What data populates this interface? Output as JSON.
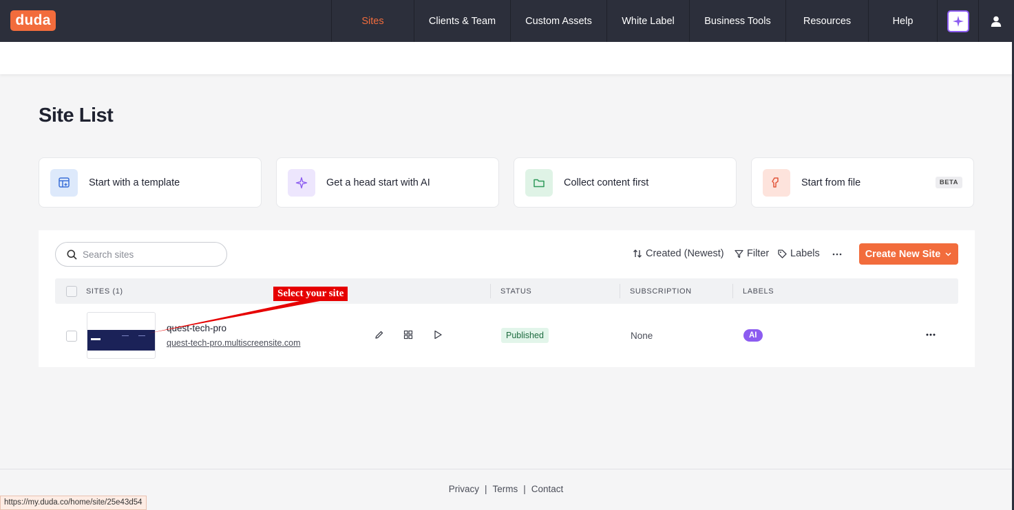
{
  "logo": "duda",
  "nav": {
    "items": [
      "Sites",
      "Clients & Team",
      "Custom Assets",
      "White Label",
      "Business Tools",
      "Resources",
      "Help"
    ]
  },
  "page_title": "Site List",
  "cards": [
    {
      "label": "Start with a template",
      "icon": "template-icon"
    },
    {
      "label": "Get a head start with AI",
      "icon": "sparkle-icon"
    },
    {
      "label": "Collect content first",
      "icon": "folder-icon"
    },
    {
      "label": "Start from file",
      "icon": "file-icon",
      "badge": "BETA"
    }
  ],
  "search": {
    "placeholder": "Search sites"
  },
  "toolbar": {
    "sort_label": "Created (Newest)",
    "filter_label": "Filter",
    "labels_label": "Labels",
    "create_label": "Create New Site"
  },
  "table": {
    "headers": [
      "SITES (1)",
      "STATUS",
      "SUBSCRIPTION",
      "LABELS"
    ],
    "rows": [
      {
        "name": "quest-tech-pro",
        "url": "quest-tech-pro.multiscreensite.com",
        "status": "Published",
        "subscription": "None",
        "label": "AI"
      }
    ]
  },
  "annotation": "Select your site",
  "footer": {
    "privacy": "Privacy",
    "sep": "|",
    "terms": "Terms",
    "contact": "Contact"
  },
  "status_bar_url": "https://my.duda.co/home/site/25e43d54",
  "colors": {
    "brand": "#f26c3c",
    "nav_bg": "#2c2f3b",
    "ai_purple": "#8c5cf0",
    "published_bg": "#e2f5ea"
  }
}
